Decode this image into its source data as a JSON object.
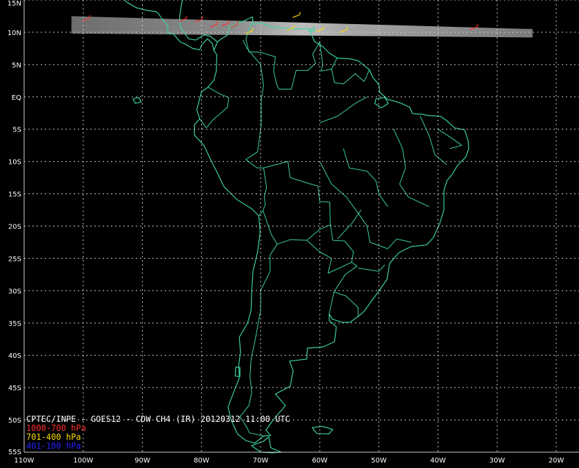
{
  "map": {
    "title": "CPTEC/INPE - GOES12 - CDW CH4 (IR) 20120312 11:00 UTC",
    "extent": {
      "lon_min": -110,
      "lon_max": -20,
      "lat_min": -55,
      "lat_max": 15
    },
    "lat_labels": [
      "15N",
      "10N",
      "5N",
      "EQ",
      "5S",
      "10S",
      "15S",
      "20S",
      "25S",
      "30S",
      "35S",
      "40S",
      "45S",
      "50S",
      "55S"
    ],
    "lat_values": [
      15,
      10,
      5,
      0,
      -5,
      -10,
      -15,
      -20,
      -25,
      -30,
      -35,
      -40,
      -45,
      -50,
      -55
    ],
    "lon_labels": [
      "110W",
      "100W",
      "90W",
      "80W",
      "70W",
      "60W",
      "50W",
      "40W",
      "30W",
      "20W"
    ],
    "lon_values": [
      -110,
      -100,
      -90,
      -80,
      -70,
      -60,
      -50,
      -40,
      -30,
      -20
    ],
    "colors": {
      "background": "#000000",
      "coastline": "#3cd49a",
      "grid": "#d0d0d0",
      "labels": "#ffffff",
      "satellite_swath": "#8a8a8a"
    },
    "satellite_swath": {
      "lon_min": -102,
      "lon_max": -24,
      "lat_top_west": 12.5,
      "lat_top_east": 10.5,
      "lat_bottom_west": 9.8,
      "lat_bottom_east": 9.2
    },
    "wind_vectors": [
      {
        "lon": -99.5,
        "lat": 12.0,
        "level": "low"
      },
      {
        "lon": -83.2,
        "lat": 11.9,
        "level": "low"
      },
      {
        "lon": -80.5,
        "lat": 11.8,
        "level": "low"
      },
      {
        "lon": -78.0,
        "lat": 11.0,
        "level": "low"
      },
      {
        "lon": -76.0,
        "lat": 11.2,
        "level": "low"
      },
      {
        "lon": -74.5,
        "lat": 11.0,
        "level": "low"
      },
      {
        "lon": -64.0,
        "lat": 12.5,
        "level": "mid"
      },
      {
        "lon": -72.0,
        "lat": 10.0,
        "level": "mid"
      },
      {
        "lon": -60.0,
        "lat": 10.3,
        "level": "mid"
      },
      {
        "lon": -56.0,
        "lat": 10.2,
        "level": "mid"
      },
      {
        "lon": -34.0,
        "lat": 10.6,
        "level": "low"
      },
      {
        "lon": -65.0,
        "lat": 10.5,
        "level": "mid"
      }
    ]
  },
  "legend": {
    "items": [
      {
        "label": "1000-700 hPa",
        "color": "#ff3030"
      },
      {
        "label": "701-400 hPa",
        "color": "#ffd800"
      },
      {
        "label": "401-100 hPa",
        "color": "#2424ff"
      }
    ]
  }
}
